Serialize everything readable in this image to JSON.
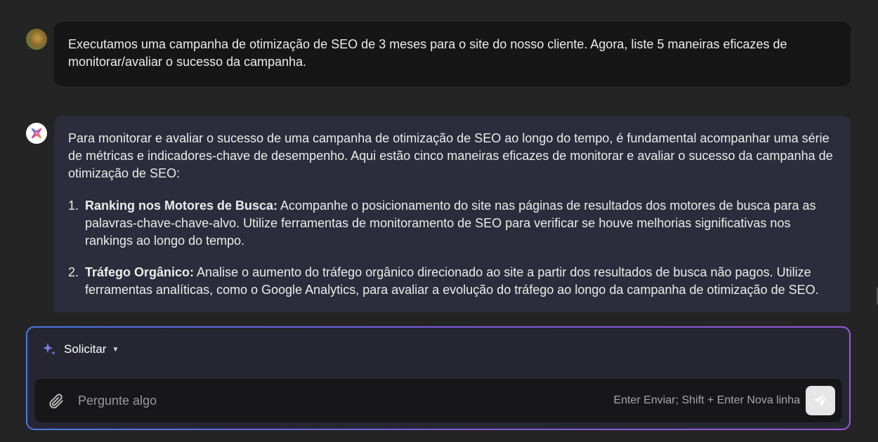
{
  "messages": {
    "user": {
      "text": "Executamos uma campanha de otimização de SEO de 3 meses para o site do nosso cliente. Agora, liste 5 maneiras eficazes de monitorar/avaliar o sucesso da campanha."
    },
    "assistant": {
      "intro": "Para monitorar e avaliar o sucesso de uma campanha de otimização de SEO ao longo do tempo, é fundamental acompanhar uma série de métricas e indicadores-chave de desempenho. Aqui estão cinco maneiras eficazes de monitorar e avaliar o sucesso da campanha de otimização de SEO:",
      "items": [
        {
          "number": "1.",
          "title": "Ranking nos Motores de Busca:",
          "text": " Acompanhe o posicionamento do site nas páginas de resultados dos motores de busca para as palavras-chave-chave-alvo. Utilize ferramentas de monitoramento de SEO para verificar se houve melhorias significativas nos rankings ao longo do tempo."
        },
        {
          "number": "2.",
          "title": "Tráfego Orgânico:",
          "text": " Analise o aumento do tráfego orgânico direcionado ao site a partir dos resultados de busca não pagos. Utilize ferramentas analíticas, como o Google Analytics, para avaliar a evolução do tráfego ao longo da campanha de otimização de SEO."
        }
      ]
    }
  },
  "composer": {
    "mode_label": "Solicitar",
    "mode_icon": "sparkle-icon",
    "placeholder": "Pergunte algo",
    "value": "",
    "hint": "Enter Enviar; Shift + Enter Nova linha",
    "attach_icon": "paperclip-icon",
    "send_icon": "send-icon"
  },
  "colors": {
    "background": "#242424",
    "user_bubble": "#161616",
    "assistant_bubble": "#2d2c3c",
    "composer_border_start": "#4a7ae8",
    "composer_border_end": "#9a5ad8"
  }
}
